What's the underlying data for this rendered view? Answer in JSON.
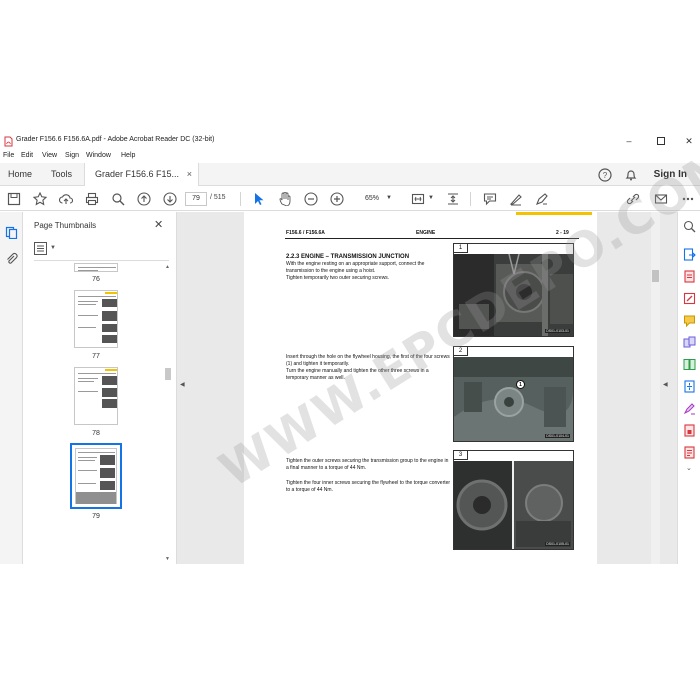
{
  "window": {
    "title": "Grader F156.6 F156.6A.pdf - Adobe Acrobat Reader DC (32-bit)",
    "minimize_icon": "minimize-icon",
    "maximize_icon": "maximize-icon",
    "close_icon": "close-icon"
  },
  "menu": [
    "File",
    "Edit",
    "View",
    "Sign",
    "Window",
    "Help"
  ],
  "tabs": {
    "home": "Home",
    "tools": "Tools",
    "document": "Grader F156.6 F15...",
    "close": "×",
    "sign_in": "Sign In"
  },
  "toolbar": {
    "current_page": "79",
    "total_pages": "/ 515",
    "zoom": "65%"
  },
  "thumbnails_panel": {
    "title": "Page Thumbnails",
    "close": "✕",
    "pages": [
      {
        "label": "76"
      },
      {
        "label": "77"
      },
      {
        "label": "78"
      },
      {
        "label": "79"
      }
    ]
  },
  "document_page": {
    "header_left": "F156.6 / F156.6A",
    "header_center": "ENGINE",
    "header_right": "2 - 19",
    "section": "2.2.3   ENGINE – TRANSMISSION JUNCTION",
    "paragraphs": [
      "With the engine resting on an appropriate support, connect the transmission to the engine using a hoist.\nTighten temporarily two outer securing screws.",
      "Insert through the hole on the flywheel housing, the first of the four screws (1) and tighten it temporarily.\nTurn the engine manually and tighten the other three screws in a temporary manner as well.",
      "Tighten the outer screws securing the transmission group to the engine in a final manner to a torque of 44 Nm.",
      "Tighten the four inner screws securing the flywheel to the torque converter to a torque of 44 Nm."
    ],
    "figures": [
      {
        "number": "1",
        "code": "DS01-0103-01"
      },
      {
        "number": "2",
        "code": "DS01-0104-01",
        "callout": "1"
      },
      {
        "number": "3",
        "code": "DS01-0105-01"
      }
    ],
    "watermark": "WWW.EPCDEPO.COM"
  },
  "colors": {
    "accent_blue": "#1473e6",
    "acrobat_red": "#d7373f",
    "yellow_tab": "#f3c200",
    "canvas_gray": "#e9e9e9"
  }
}
